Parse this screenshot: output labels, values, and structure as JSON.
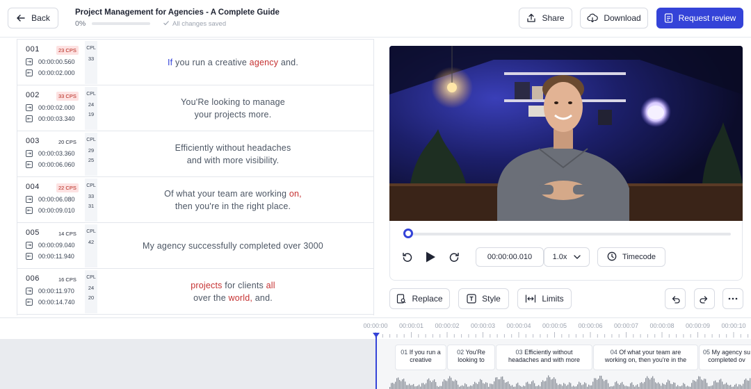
{
  "header": {
    "back_label": "Back",
    "title": "Project Management for Agencies - A Complete Guide",
    "progress_text": "0%",
    "progress_value": 0.0,
    "saved_text": "All changes saved",
    "share_label": "Share",
    "download_label": "Download",
    "review_label": "Request review"
  },
  "subtitles": [
    {
      "num": "001",
      "cps": "23 CPS",
      "cps_warn": true,
      "start": "00:00:00.560",
      "end": "00:00:02.000",
      "cpl_label": "CPL",
      "cpl": [
        "33"
      ],
      "lines": [
        [
          {
            "t": "If",
            "c": "blue"
          },
          {
            "t": " you run a creative "
          },
          {
            "t": "agency",
            "c": "red"
          },
          {
            "t": " and."
          }
        ]
      ]
    },
    {
      "num": "002",
      "cps": "33 CPS",
      "cps_warn": true,
      "start": "00:00:02.000",
      "end": "00:00:03.340",
      "cpl_label": "CPL",
      "cpl": [
        "24",
        "19"
      ],
      "lines": [
        [
          {
            "t": "You'Re looking to manage"
          }
        ],
        [
          {
            "t": "your projects more."
          }
        ]
      ]
    },
    {
      "num": "003",
      "cps": "20 CPS",
      "cps_warn": false,
      "start": "00:00:03.360",
      "end": "00:00:06.060",
      "cpl_label": "CPL",
      "cpl": [
        "29",
        "25"
      ],
      "lines": [
        [
          {
            "t": "Efficiently without headaches"
          }
        ],
        [
          {
            "t": "and with more visibility."
          }
        ]
      ]
    },
    {
      "num": "004",
      "cps": "22 CPS",
      "cps_warn": true,
      "start": "00:00:06.080",
      "end": "00:00:09.010",
      "cpl_label": "CPL",
      "cpl": [
        "33",
        "31"
      ],
      "lines": [
        [
          {
            "t": "Of what your team are working "
          },
          {
            "t": "on,",
            "c": "red"
          }
        ],
        [
          {
            "t": "then you're in the right place."
          }
        ]
      ]
    },
    {
      "num": "005",
      "cps": "14 CPS",
      "cps_warn": false,
      "start": "00:00:09.040",
      "end": "00:00:11.940",
      "cpl_label": "CPL",
      "cpl": [
        "42"
      ],
      "lines": [
        [
          {
            "t": "My agency successfully completed over 3000"
          }
        ]
      ]
    },
    {
      "num": "006",
      "cps": "16 CPS",
      "cps_warn": false,
      "start": "00:00:11.970",
      "end": "00:00:14.740",
      "cpl_label": "CPL",
      "cpl": [
        "24",
        "20"
      ],
      "lines": [
        [
          {
            "t": "projects",
            "c": "red"
          },
          {
            "t": " for clients "
          },
          {
            "t": "all",
            "c": "red"
          }
        ],
        [
          {
            "t": "over the "
          },
          {
            "t": "world,",
            "c": "red"
          },
          {
            "t": " and."
          }
        ]
      ]
    }
  ],
  "player": {
    "position_fraction": 0.002,
    "current_time": "00:00:00.010",
    "speed": "1.0x",
    "timecode_label": "Timecode"
  },
  "toolbar": {
    "replace_label": "Replace",
    "style_label": "Style",
    "limits_label": "Limits"
  },
  "timeline": {
    "ticks": [
      "00:00:00",
      "00:00:01",
      "00:00:02",
      "00:00:03",
      "00:00:04",
      "00:00:05",
      "00:00:06",
      "00:00:07",
      "00:00:08",
      "00:00:09",
      "00:00:10"
    ],
    "segments": [
      {
        "num": "01",
        "line1": "If you run a",
        "line2": "creative"
      },
      {
        "num": "02",
        "line1": "You'Re",
        "line2": "looking to"
      },
      {
        "num": "03",
        "line1": "Efficiently without",
        "line2": "headaches and with more"
      },
      {
        "num": "04",
        "line1": "Of what your team are",
        "line2": "working on, then you're in the"
      },
      {
        "num": "05",
        "line1": "My agency su",
        "line2": "completed ov"
      }
    ]
  },
  "colors": {
    "accent": "#3443d8",
    "warning_bg": "#fde2e2",
    "warning_text": "#c53030"
  }
}
